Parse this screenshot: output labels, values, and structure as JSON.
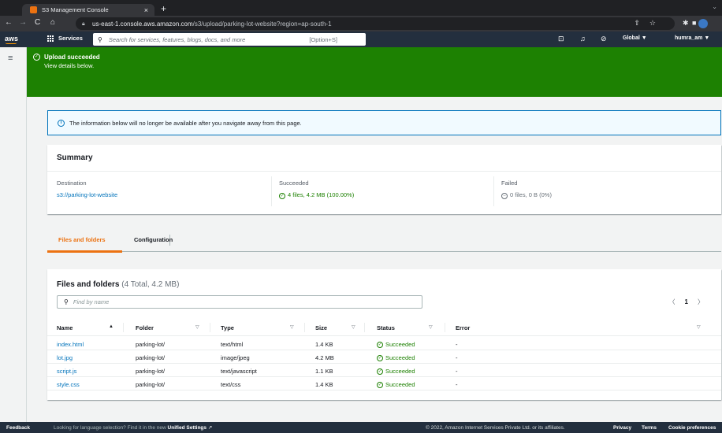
{
  "browser": {
    "tab_title": "S3 Management Console",
    "tab_close": "×",
    "new_tab": "+",
    "url_host": "us-east-1.console.aws.amazon.com",
    "url_path": "/s3/upload/parking-lot-website?region=ap-south-1"
  },
  "aws_header": {
    "logo": "aws",
    "services_label": "Services",
    "search_placeholder": "Search for services, features, blogs, docs, and more",
    "search_shortcut": "[Option+S]",
    "region": "Global ▼",
    "account": "humra_am ▼"
  },
  "flash": {
    "title": "Upload succeeded",
    "subtitle": "View details below."
  },
  "info_alert": {
    "text": "The information below will no longer be available after you navigate away from this page."
  },
  "summary": {
    "title": "Summary",
    "destination_label": "Destination",
    "destination_value": "s3://parking-lot-website",
    "succeeded_label": "Succeeded",
    "succeeded_value": "4 files, 4.2 MB (100.00%)",
    "failed_label": "Failed",
    "failed_value": "0 files, 0 B (0%)"
  },
  "tabs": {
    "files_and_folders": "Files and folders",
    "configuration": "Configuration"
  },
  "files": {
    "title": "Files and folders",
    "count": "(4 Total, 4.2 MB)",
    "find_placeholder": "Find by name",
    "page": "1",
    "prev": "〈",
    "next": "〉",
    "columns": {
      "name": "Name",
      "folder": "Folder",
      "type": "Type",
      "size": "Size",
      "status": "Status",
      "error": "Error"
    },
    "rows": [
      {
        "name": "index.html",
        "folder": "parking-lot/",
        "type": "text/html",
        "size": "1.4 KB",
        "status": "Succeeded",
        "error": "-"
      },
      {
        "name": "lot.jpg",
        "folder": "parking-lot/",
        "type": "image/jpeg",
        "size": "4.2 MB",
        "status": "Succeeded",
        "error": "-"
      },
      {
        "name": "script.js",
        "folder": "parking-lot/",
        "type": "text/javascript",
        "size": "1.1 KB",
        "status": "Succeeded",
        "error": "-"
      },
      {
        "name": "style.css",
        "folder": "parking-lot/",
        "type": "text/css",
        "size": "1.4 KB",
        "status": "Succeeded",
        "error": "-"
      }
    ]
  },
  "footer": {
    "feedback": "Feedback",
    "lang_text": "Looking for language selection? Find it in the new",
    "lang_link": "Unified Settings",
    "copyright": "© 2022, Amazon Internet Services Private Ltd. or its affiliates.",
    "privacy": "Privacy",
    "terms": "Terms",
    "cookies": "Cookie preferences"
  },
  "colors": {
    "success": "#1d8102",
    "link": "#0073bb",
    "accent": "#ec7211",
    "aws_nav": "#232f3e"
  }
}
